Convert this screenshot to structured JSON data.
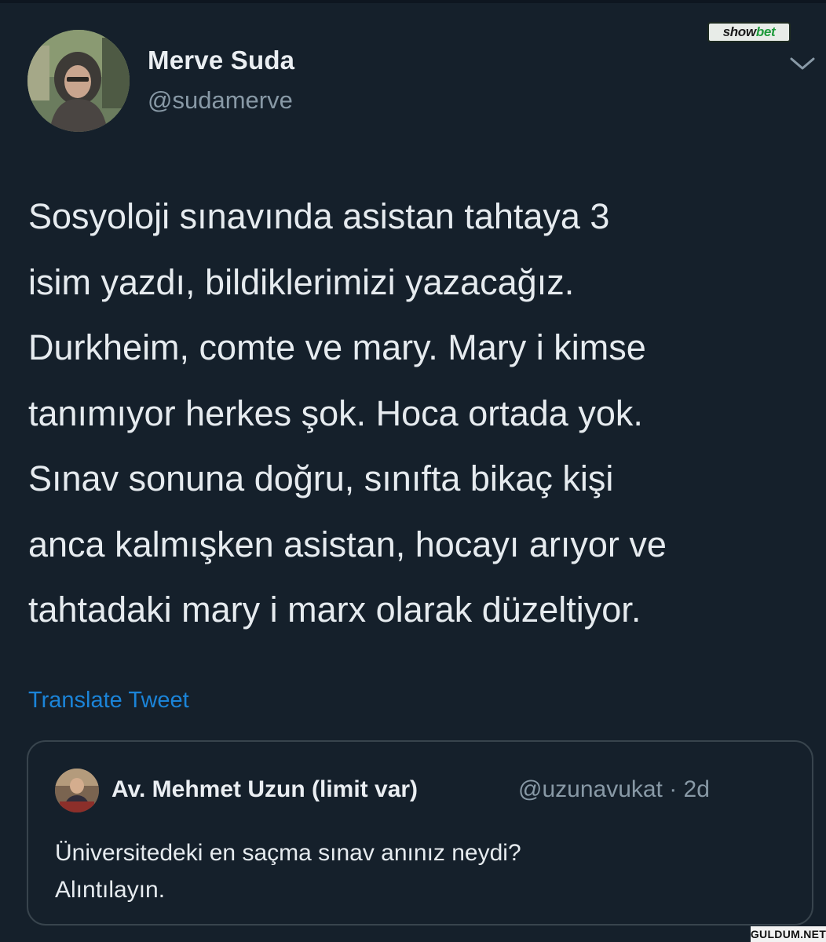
{
  "tweet": {
    "author": {
      "display_name": "Merve Suda",
      "handle": "@sudamerve",
      "avatar_icon": "profile-photo"
    },
    "menu_icon": "chevron-down-icon",
    "text_lines": [
      "Sosyoloji sınavında asistan tahtaya 3",
      "isim yazdı, bildiklerimizi yazacağız.",
      "Durkheim, comte ve mary. Mary i kimse",
      "tanımıyor herkes şok. Hoca ortada yok.",
      "Sınav sonuna doğru, sınıfta bikaç kişi",
      "anca kalmışken asistan, hocayı arıyor ve",
      "tahtadaki mary i marx olarak düzeltiyor."
    ],
    "translate_label": "Translate Tweet"
  },
  "quoted_tweet": {
    "author": {
      "display_name": "Av. Mehmet Uzun (limit var)",
      "handle_and_time": "@uzunavukat · 2d"
    },
    "text_lines": [
      "Üniversitedeki en saçma sınav anınız neydi?",
      "Alıntılayın."
    ]
  },
  "watermarks": {
    "top_part1": "show",
    "top_part2": "bet",
    "bottom": "GULDUM.NET"
  },
  "colors": {
    "background": "#15202b",
    "link": "#1b84d8",
    "secondary_text": "#8899a6",
    "border": "#38444d"
  }
}
